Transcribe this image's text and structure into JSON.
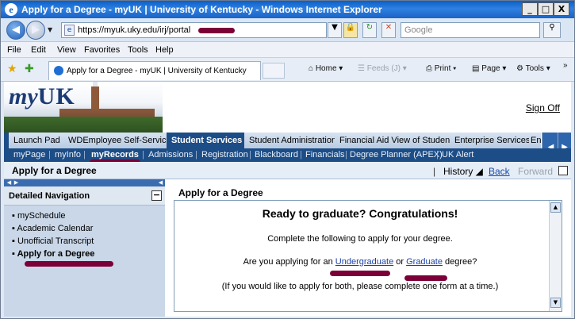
{
  "window": {
    "title": "Apply for a Degree - myUK | University of Kentucky - Windows Internet Explorer",
    "controls": [
      "_",
      "□",
      "X"
    ]
  },
  "address": {
    "url": "https://myuk.uky.edu/irj/portal",
    "search_placeholder": "Google"
  },
  "menu": [
    "File",
    "Edit",
    "View",
    "Favorites",
    "Tools",
    "Help"
  ],
  "tab": {
    "title": "Apply for a Degree - myUK | University of Kentucky"
  },
  "commands": {
    "home": "Home",
    "feeds": "Feeds (J)",
    "print": "Print",
    "page": "Page",
    "tools": "Tools",
    "more": "»"
  },
  "portal": {
    "logo_my": "my",
    "logo_uk": "UK",
    "sign_off": "Sign Off",
    "top_tabs": [
      "Launch Pad",
      "WDEmployee Self-Service",
      "Student Services",
      "Student Administration",
      "Financial Aid View of Student",
      "Enterprise Services",
      "En"
    ],
    "sub_tabs": [
      "myPage",
      "myInfo",
      "myRecords",
      "Admissions",
      "Registration",
      "Blackboard",
      "Financials",
      "Degree Planner (APEX)",
      "UK Alert"
    ],
    "page_title": "Apply for a Degree",
    "history": "History",
    "back": "Back",
    "forward": "Forward"
  },
  "detailed_nav": {
    "header": "Detailed Navigation",
    "items": [
      "mySchedule",
      "Academic Calendar",
      "Unofficial Transcript",
      "Apply for a Degree"
    ]
  },
  "content": {
    "title": "Apply for a Degree",
    "heading": "Ready to graduate? Congratulations!",
    "line1": "Complete the following to apply for your degree.",
    "line2_prefix": "Are you applying for an",
    "line2_link1": "Undergraduate",
    "line2_mid": "or",
    "line2_link2": "Graduate",
    "line2_suffix": "degree?",
    "line3": "(If you would like to apply for both, please complete one form at a time.)"
  },
  "colors": {
    "accent": "#1d4d86",
    "title_bar": "#1a63c6",
    "redaction": "#7b0038"
  }
}
